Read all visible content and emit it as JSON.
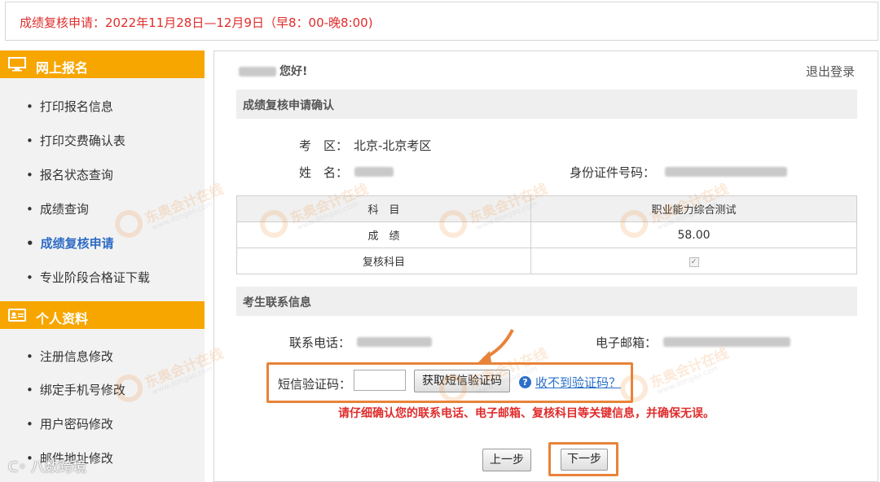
{
  "notice": {
    "text": "成绩复核申请：2022年11月28日—12月9日（早8：00-晚8:00)"
  },
  "sidebar": {
    "section1": {
      "title": "网上报名",
      "icon": "monitor-icon"
    },
    "section1_items": [
      {
        "label": "打印报名信息"
      },
      {
        "label": "打印交费确认表"
      },
      {
        "label": "报名状态查询"
      },
      {
        "label": "成绩查询"
      },
      {
        "label": "成绩复核申请",
        "active": true
      },
      {
        "label": "专业阶段合格证下载"
      }
    ],
    "section2": {
      "title": "个人资料",
      "icon": "id-card-icon"
    },
    "section2_items": [
      {
        "label": "注册信息修改"
      },
      {
        "label": "绑定手机号修改"
      },
      {
        "label": "用户密码修改"
      },
      {
        "label": "邮件地址修改"
      }
    ]
  },
  "main": {
    "greeting": "您好!",
    "logout": "退出登录",
    "confirm_section_title": "成绩复核申请确认",
    "exam_area_label": "考　区：",
    "exam_area_value": "北京-北京考区",
    "name_label": "姓　名：",
    "id_label": "身份证件号码：",
    "table": {
      "header": [
        "科　目",
        "职业能力综合测试"
      ],
      "rows": [
        {
          "label": "成　绩",
          "value": "58.00"
        },
        {
          "label": "复核科目",
          "value": "✓"
        }
      ]
    },
    "contact_section_title": "考生联系信息",
    "phone_label": "联系电话：",
    "email_label": "电子邮箱：",
    "sms_label": "短信验证码：",
    "sms_placeholder": "",
    "get_code_button": "获取短信验证码",
    "help_icon": "?",
    "help_link": "收不到验证码？",
    "warning": "请仔细确认您的联系电话、电子邮箱、复核科目等关键信息，并确保无误。",
    "prev_button": "上一步",
    "next_button": "下一步"
  },
  "watermark": {
    "brand": "东奥会计在线",
    "domain": "www.dongao.com"
  },
  "corner_mark": "八数跨境",
  "colors": {
    "accent": "#f7a600",
    "warning": "#e02c2c",
    "link": "#2a6fc9",
    "highlight": "#e8833a"
  }
}
